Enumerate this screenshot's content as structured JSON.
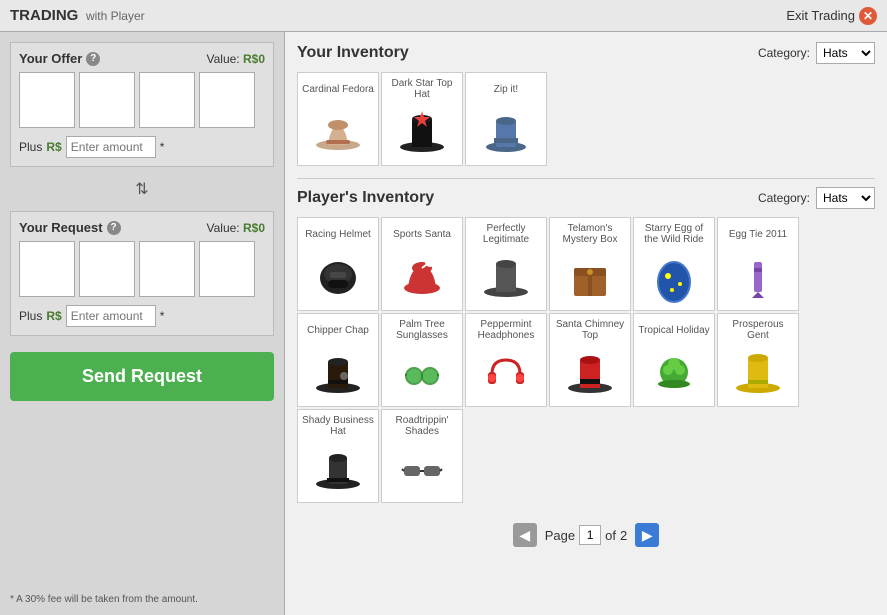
{
  "header": {
    "title": "TRADING",
    "with_label": "with Player",
    "exit_label": "Exit Trading"
  },
  "left_panel": {
    "offer_title": "Your Offer",
    "offer_value_label": "Value:",
    "offer_value": "R$0",
    "request_title": "Your Request",
    "request_value_label": "Value:",
    "request_value": "R$0",
    "plus_label": "Plus",
    "robux_label": "R$",
    "amount_placeholder": "Enter amount",
    "asterisk": "*",
    "send_btn_label": "Send Request",
    "fee_note": "* A 30% fee will be taken from the amount."
  },
  "your_inventory": {
    "title": "Your Inventory",
    "category_label": "Category:",
    "category_value": "Hats",
    "items": [
      {
        "name": "Cardinal Fedora",
        "icon": "🎩",
        "color": "#c8a88a"
      },
      {
        "name": "Dark Star Top Hat",
        "icon": "🎩",
        "color": "#222"
      },
      {
        "name": "Zip it!",
        "icon": "🎩",
        "color": "#5577aa"
      }
    ]
  },
  "player_inventory": {
    "title": "Player's Inventory",
    "category_label": "Category:",
    "category_value": "Hats",
    "items": [
      {
        "name": "Racing Helmet",
        "icon": "⛑",
        "color": "#222"
      },
      {
        "name": "Sports Santa",
        "icon": "🎅",
        "color": "#cc3333"
      },
      {
        "name": "Perfectly Legitimate",
        "icon": "🎩",
        "color": "#555"
      },
      {
        "name": "Telamon's Mystery Box",
        "icon": "📦",
        "color": "#a0602a"
      },
      {
        "name": "Starry Egg of the Wild Ride",
        "icon": "🥚",
        "color": "#3355aa"
      },
      {
        "name": "Egg Tie 2011",
        "icon": "👔",
        "color": "#9966cc"
      },
      {
        "name": "Chipper Chap",
        "icon": "🎩",
        "color": "#332211"
      },
      {
        "name": "Palm Tree Sunglasses",
        "icon": "🕶",
        "color": "#33aa33"
      },
      {
        "name": "Peppermint Headphones",
        "icon": "🎧",
        "color": "#cc2222"
      },
      {
        "name": "Santa Chimney Top",
        "icon": "🎩",
        "color": "#333"
      },
      {
        "name": "Tropical Holiday",
        "icon": "🌴",
        "color": "#44aa33"
      },
      {
        "name": "Prosperous Gent",
        "icon": "🎩",
        "color": "#ccaa00"
      },
      {
        "name": "Shady Business Hat",
        "icon": "🎩",
        "color": "#333"
      },
      {
        "name": "Roadtrippin' Shades",
        "icon": "🕶",
        "color": "#555"
      }
    ],
    "pagination": {
      "page_label": "Page",
      "current_page": "1",
      "total_pages": "2",
      "of_label": "of"
    }
  }
}
